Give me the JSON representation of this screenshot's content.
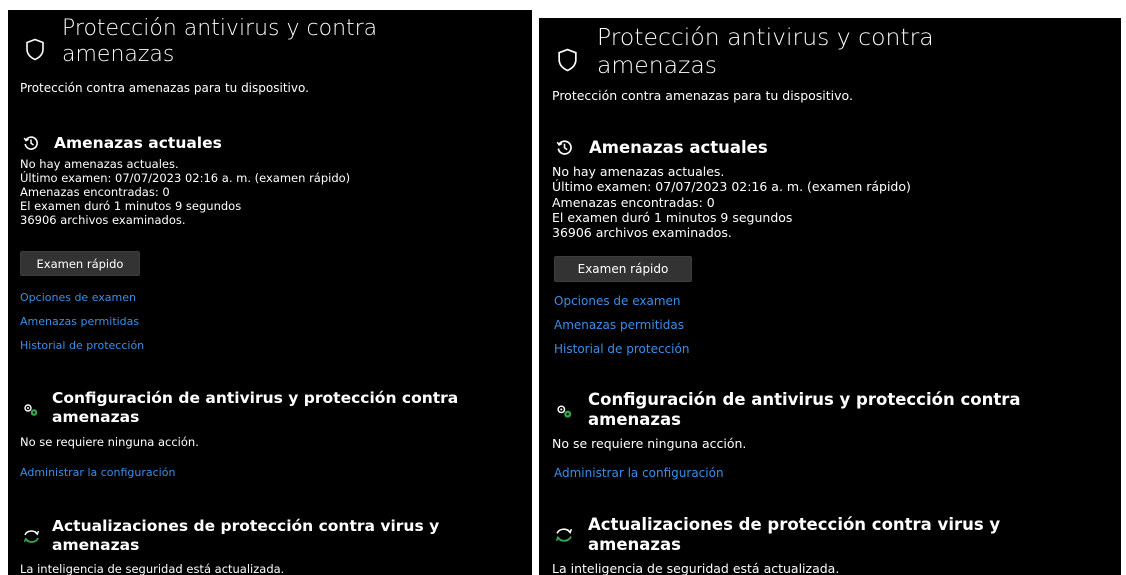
{
  "page": {
    "title": "Protección antivirus y contra amenazas",
    "title_line1": "Protección antivirus y contra",
    "title_line2": "amenazas",
    "subtitle": "Protección contra amenazas para tu dispositivo.",
    "header_icon": "shield-icon"
  },
  "current_threats": {
    "icon": "history-clock-icon",
    "title": "Amenazas actuales",
    "lines": [
      "No hay amenazas actuales.",
      "Último examen: 07/07/2023 02:16 a. m. (examen rápido)",
      "Amenazas encontradas: 0",
      "El examen duró 1 minutos 9 segundos",
      "36906 archivos examinados."
    ],
    "quick_scan_label": "Examen rápido",
    "links": [
      "Opciones de examen",
      "Amenazas permitidas",
      "Historial de protección"
    ]
  },
  "settings": {
    "icon": "gears-icon",
    "title_line1": "Configuración de antivirus y protección contra",
    "title_line2": "amenazas",
    "status": "No se requiere ninguna acción.",
    "link": "Administrar la configuración"
  },
  "updates": {
    "icon": "sync-icon",
    "title_line1": "Actualizaciones de protección contra virus y",
    "title_line2": "amenazas",
    "status": "La inteligencia de seguridad está actualizada."
  },
  "colors": {
    "background": "#000000",
    "text": "#ffffff",
    "link": "#3b8ee8",
    "button": "#333333",
    "icon_green": "#2fa84f"
  }
}
